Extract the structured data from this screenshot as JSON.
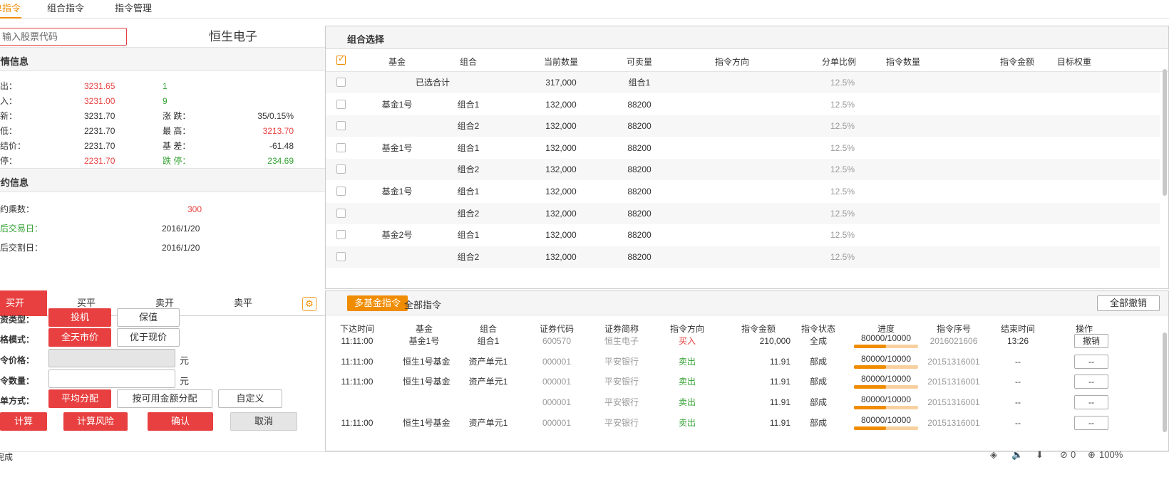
{
  "top_tabs": [
    "单指令",
    "组合指令",
    "指令管理"
  ],
  "quote": {
    "search_placeholder": "输入股票代码",
    "stock_name": "恒生电子",
    "section_title": "行情信息",
    "rows": [
      {
        "l1": "卖出：",
        "v1": "3231.65",
        "v1c": "red",
        "l2": "1",
        "l2c": "green",
        "v2": "",
        "v2c": ""
      },
      {
        "l1": "买入：",
        "v1": "3231.00",
        "v1c": "red",
        "l2": "9",
        "l2c": "green",
        "v2": "",
        "v2c": ""
      },
      {
        "l1": "最新：",
        "v1": "3231.70",
        "v1c": "",
        "l2": "涨  跌：",
        "l2c": "",
        "v2": "35/0.15%",
        "v2c": ""
      },
      {
        "l1": "最低：",
        "v1": "2231.70",
        "v1c": "",
        "l2": "最  高：",
        "l2c": "",
        "v2": "3213.70",
        "v2c": "red"
      },
      {
        "l1": "昨结价：",
        "v1": "2231.70",
        "v1c": "",
        "l2": "基  差：",
        "l2c": "",
        "v2": "-61.48",
        "v2c": ""
      },
      {
        "l1": "涨停：",
        "v1": "2231.70",
        "v1c": "red",
        "l2": "跌  停：",
        "l2c": "green",
        "v2": "234.69",
        "v2c": "green"
      }
    ]
  },
  "contract": {
    "section_title": "合约信息",
    "rows": [
      {
        "label": "合约乘数：",
        "labelc": "",
        "value": "300",
        "valuec": "red",
        "vx": 263
      },
      {
        "label": "最后交易日：",
        "labelc": "green",
        "value": "2016/1/20",
        "valuec": "",
        "vx": 227
      },
      {
        "label": "最后交割日：",
        "labelc": "",
        "value": "2016/1/20",
        "valuec": "",
        "vx": 227
      }
    ]
  },
  "portfolio": {
    "title": "组合选择",
    "headers": [
      "基金",
      "组合",
      "当前数量",
      "可卖量",
      "指令方向",
      "分单比例",
      "指令数量",
      "指令金额",
      "目标权重"
    ],
    "rows": [
      {
        "fund": "已选合计",
        "combo": "",
        "qty": "317,000",
        "sellable": "组合1",
        "ratio": "12.5%"
      },
      {
        "fund": "基金1号",
        "combo": "组合1",
        "qty": "132,000",
        "sellable": "88200",
        "ratio": "12.5%"
      },
      {
        "fund": "",
        "combo": "组合2",
        "qty": "132,000",
        "sellable": "88200",
        "ratio": "12.5%"
      },
      {
        "fund": "基金1号",
        "combo": "组合1",
        "qty": "132,000",
        "sellable": "88200",
        "ratio": "12.5%"
      },
      {
        "fund": "",
        "combo": "组合2",
        "qty": "132,000",
        "sellable": "88200",
        "ratio": "12.5%"
      },
      {
        "fund": "基金1号",
        "combo": "组合1",
        "qty": "132,000",
        "sellable": "88200",
        "ratio": "12.5%"
      },
      {
        "fund": "",
        "combo": "组合2",
        "qty": "132,000",
        "sellable": "88200",
        "ratio": "12.5%"
      },
      {
        "fund": "基金2号",
        "combo": "组合1",
        "qty": "132,000",
        "sellable": "88200",
        "ratio": "12.5%"
      },
      {
        "fund": "",
        "combo": "组合2",
        "qty": "132,000",
        "sellable": "88200",
        "ratio": "12.5%"
      }
    ]
  },
  "order_form": {
    "tabs": [
      "买开",
      "买平",
      "卖开",
      "卖平"
    ],
    "invest_type_label": "投资类型：",
    "invest_type_options": [
      "投机",
      "保值"
    ],
    "price_mode_label": "价格模式：",
    "price_mode_options": [
      "全天市价",
      "优于现价"
    ],
    "price_label": "指令价格：",
    "qty_label": "指令数量：",
    "unit": "元",
    "split_label": "分单方式：",
    "split_options": [
      "平均分配",
      "按可用金额分配",
      "自定义"
    ],
    "actions": [
      "计算",
      "计算风险",
      "确认",
      "取消"
    ]
  },
  "orders": {
    "tab_active": "多基金指令",
    "tab_other": "全部指令",
    "cancel_all": "全部撤销",
    "headers": [
      "下达时间",
      "基金",
      "组合",
      "证券代码",
      "证券简称",
      "指令方向",
      "指令金额",
      "指令状态",
      "进度",
      "指令序号",
      "结束时间",
      "操作"
    ],
    "rows": [
      {
        "time": "11:11:00",
        "fund": "基金1号",
        "combo": "组合1",
        "code": "600570",
        "name": "恒生电子",
        "dir": "买入",
        "dirc": "red",
        "amount": "210,000",
        "status": "全成",
        "progress_text": "80000/10000",
        "progress_pct": 50,
        "seq": "2016021606",
        "end": "13:26",
        "op": "撤销"
      },
      {
        "time": "11:11:00",
        "fund": "恒生1号基金",
        "combo": "资产单元1",
        "code": "000001",
        "name": "平安银行",
        "dir": "卖出",
        "dirc": "green",
        "amount": "11.91",
        "status": "部成",
        "progress_text": "80000/10000",
        "progress_pct": 50,
        "seq": "20151316001",
        "end": "--",
        "op": "--"
      },
      {
        "time": "11:11:00",
        "fund": "恒生1号基金",
        "combo": "资产单元1",
        "code": "000001",
        "name": "平安银行",
        "dir": "卖出",
        "dirc": "green",
        "amount": "11.91",
        "status": "部成",
        "progress_text": "80000/10000",
        "progress_pct": 50,
        "seq": "20151316001",
        "end": "--",
        "op": "--"
      },
      {
        "time": "",
        "fund": "",
        "combo": "",
        "code": "000001",
        "name": "平安银行",
        "dir": "卖出",
        "dirc": "green",
        "amount": "11.91",
        "status": "部成",
        "progress_text": "80000/10000",
        "progress_pct": 50,
        "seq": "20151316001",
        "end": "--",
        "op": "--"
      },
      {
        "time": "11:11:00",
        "fund": "恒生1号基金",
        "combo": "资产单元1",
        "code": "000001",
        "name": "平安银行",
        "dir": "卖出",
        "dirc": "green",
        "amount": "11.91",
        "status": "部成",
        "progress_text": "80000/10000",
        "progress_pct": 50,
        "seq": "20151316001",
        "end": "--",
        "op": "--"
      }
    ]
  },
  "status_bar": {
    "left_text": "完成",
    "count": "0",
    "zoom": "100%"
  }
}
